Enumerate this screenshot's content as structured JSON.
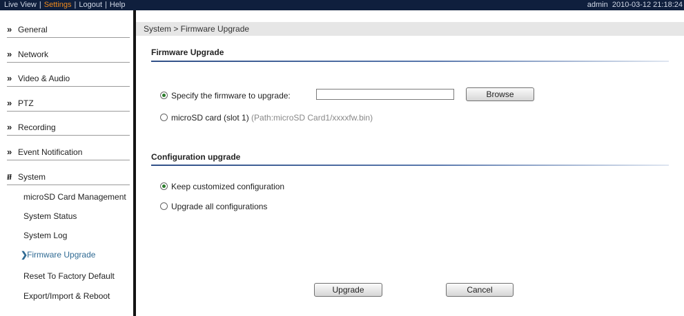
{
  "topbar": {
    "nav": [
      "Live View",
      "Settings",
      "Logout",
      "Help"
    ],
    "separator": "|",
    "user": "admin",
    "datetime": "2010-03-12 21:18:24"
  },
  "sidebar": {
    "sections": [
      "General",
      "Network",
      "Video & Audio",
      "PTZ",
      "Recording",
      "Event Notification",
      "System"
    ],
    "system_items": [
      "microSD Card Management",
      "System Status",
      "System Log",
      "Firmware Upgrade",
      "Reset To Factory Default",
      "Export/Import & Reboot"
    ],
    "active_item": "Firmware Upgrade"
  },
  "breadcrumb": "System > Firmware Upgrade",
  "firmware": {
    "heading": "Firmware Upgrade",
    "option_specify": "Specify the firmware to upgrade:",
    "option_specify_selected": true,
    "file_value": "",
    "browse_label": "Browse",
    "option_sd": "microSD card (slot 1)",
    "option_sd_path": "(Path:microSD Card1/xxxxfw.bin)",
    "option_sd_selected": false
  },
  "config": {
    "heading": "Configuration upgrade",
    "option_keep": "Keep customized configuration",
    "option_keep_selected": true,
    "option_all": "Upgrade all configurations",
    "option_all_selected": false
  },
  "actions": {
    "upgrade_label": "Upgrade",
    "cancel_label": "Cancel"
  },
  "colors": {
    "topbar_bg": "#0f1f3d",
    "active_nav": "#f08a1c",
    "active_sidebar_item": "#2f6a93",
    "heading_rule": "#2f4f87"
  },
  "icons": {
    "section_expand": "double-chevron-right",
    "section_expanded": "double-chevron-down",
    "active_item_marker": "chevron-right"
  }
}
